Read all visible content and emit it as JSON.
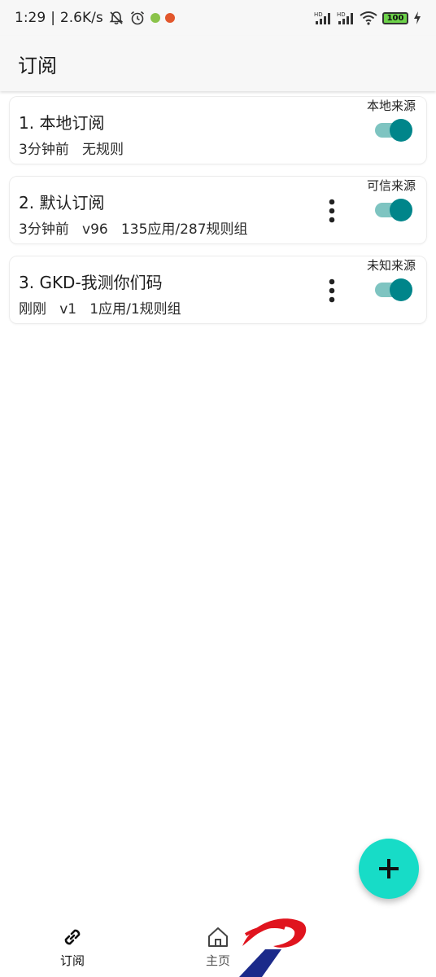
{
  "status_bar": {
    "time": "1:29",
    "separator": "|",
    "speed": "2.6K/s",
    "battery": "100",
    "icons": [
      "notifications-off-icon",
      "alarm-icon",
      "green-app-dot-icon",
      "orange-app-dot-icon",
      "hd-signal-icon",
      "hd-signal-icon",
      "wifi-icon",
      "battery-icon",
      "charging-icon"
    ]
  },
  "app_bar": {
    "title": "订阅"
  },
  "subscriptions": [
    {
      "name": "1. 本地订阅",
      "meta": "3分钟前   无规则",
      "source": "本地来源",
      "has_more": false,
      "enabled": true
    },
    {
      "name": "2. 默认订阅",
      "meta": "3分钟前   v96   135应用/287规则组",
      "source": "可信来源",
      "has_more": true,
      "enabled": true
    },
    {
      "name": "3. GKD-我测你们码",
      "meta": "刚刚   v1   1应用/1规则组",
      "source": "未知来源",
      "has_more": true,
      "enabled": true
    }
  ],
  "fab": {
    "icon": "add-icon"
  },
  "bottom_nav": {
    "items": [
      {
        "label": "订阅",
        "icon": "link-icon",
        "active": true
      },
      {
        "label": "主页",
        "icon": "home-icon",
        "active": false
      }
    ]
  },
  "colors": {
    "accent": "#00858a",
    "switch_track": "#7ec4c1",
    "fab": "#17dcc7",
    "logo_red": "#e0141e",
    "logo_blue": "#1b2a8a"
  }
}
